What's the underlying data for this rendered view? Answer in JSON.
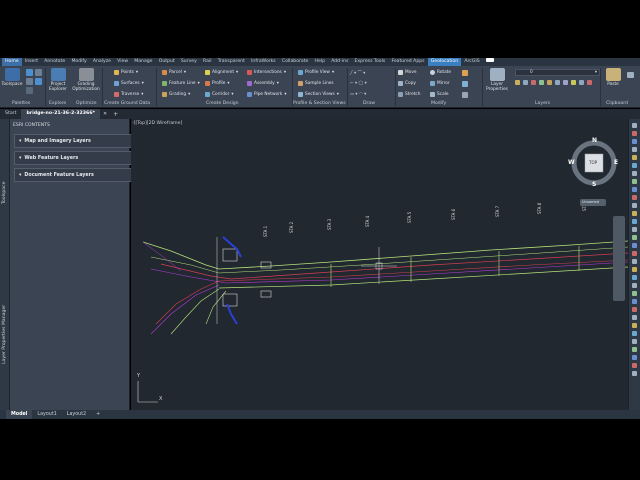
{
  "menu_tabs": [
    "Home",
    "Insert",
    "Annotate",
    "Modify",
    "Analyze",
    "View",
    "Manage",
    "Output",
    "Survey",
    "Rail",
    "Transparent",
    "InfraWorks",
    "Collaborate",
    "Help",
    "Add-ins",
    "Express Tools",
    "Featured Apps",
    "Geolocation",
    "ArcGIS"
  ],
  "ribbon": {
    "toolspace": "Toolspace",
    "palettes": "Palettes",
    "project_explorer": "Project Explorer",
    "explore": "Explore",
    "grading_opt": "Grading Optimization",
    "optimize": "Optimize",
    "points": "Points",
    "surfaces": "Surfaces",
    "traverse": "Traverse",
    "create_ground_data": "Create Ground Data",
    "parcel": "Parcel",
    "feature_line": "Feature Line",
    "grading": "Grading",
    "alignment": "Alignment",
    "profile": "Profile",
    "corridor": "Corridor",
    "intersections": "Intersections",
    "assembly": "Assembly",
    "pipe_network": "Pipe Network",
    "create_design": "Create Design",
    "profile_view": "Profile View",
    "sample_lines": "Sample Lines",
    "section_views": "Section Views",
    "profile_section_views": "Profile & Section Views",
    "draw": "Draw",
    "move": "Move",
    "copy": "Copy",
    "stretch": "Stretch",
    "rotate": "Rotate",
    "mirror": "Mirror",
    "scale": "Scale",
    "modify": "Modify",
    "layer_properties": "Layer Properties",
    "layers": "Layers",
    "layer_value": "0",
    "paste": "Paste",
    "clipboard": "Clipboard"
  },
  "file_tabs": [
    "Start",
    "bridge-no-21-36-2-32366*"
  ],
  "left_strip": {
    "toolspace": "Toolspace",
    "layer_prop": "Layer Properties Manager"
  },
  "palette": {
    "header": "ESRI CONTENTS",
    "items": [
      "Map and Imagery Layers",
      "Web Feature Layers",
      "Document Feature Layers"
    ]
  },
  "canvas": {
    "view_label": "-][Top][2D Wireframe]",
    "viewcube": {
      "n": "N",
      "s": "S",
      "e": "E",
      "w": "W",
      "top": "TOP"
    },
    "wcs": "Unnamed",
    "ucs_x": "X",
    "ucs_y": "Y"
  },
  "layout_tabs": [
    "Model",
    "Layout1",
    "Layout2",
    "+"
  ],
  "colors": {
    "accent": "#3d6fa8",
    "geolocation": "#3a7fc0",
    "road_green": "#b7e37a",
    "road_red": "#d63d52",
    "road_magenta": "#b53ad8",
    "blue_obj": "#2a3fd8"
  }
}
